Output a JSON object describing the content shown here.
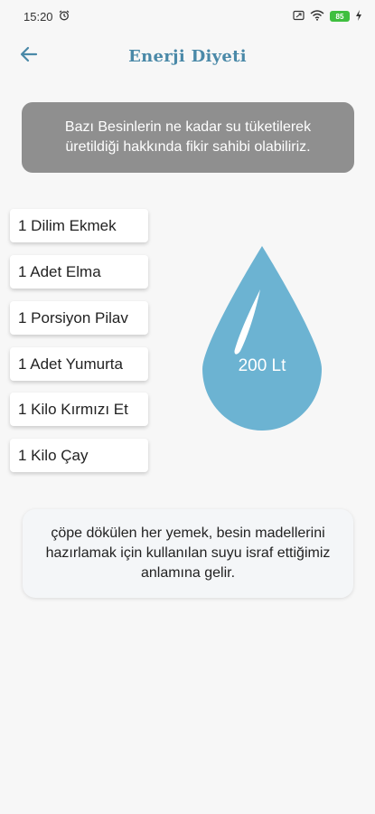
{
  "status_bar": {
    "time": "15:20",
    "battery": "85"
  },
  "app_bar": {
    "title": "Enerji Diyeti"
  },
  "info": {
    "text": "Bazı Besinlerin ne kadar su tüketilerek üretildiği hakkında fikir sahibi olabiliriz."
  },
  "foods": [
    {
      "label": "1 Dilim Ekmek"
    },
    {
      "label": "1 Adet Elma"
    },
    {
      "label": "1 Porsiyon Pilav"
    },
    {
      "label": "1 Adet Yumurta"
    },
    {
      "label": "1 Kilo Kırmızı Et"
    },
    {
      "label": "1 Kilo Çay"
    }
  ],
  "water_drop": {
    "value": "200 Lt",
    "color": "#6cb3d2"
  },
  "note": {
    "text": "çöpe dökülen her yemek, besin madellerini hazırlamak için kullanılan suyu israf ettiğimiz anlamına gelir."
  },
  "colors": {
    "accent": "#4a89a8",
    "info_box": "#8f8f8f"
  }
}
